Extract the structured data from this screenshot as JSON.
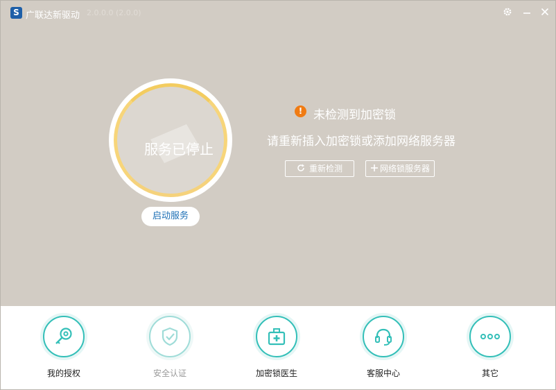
{
  "app": {
    "logo_glyph": "S",
    "title": "广联达新驱动",
    "version": "2.0.0.0 (2.0.0)"
  },
  "window_controls": {
    "settings_icon": "gear-icon",
    "minimize_icon": "minimize-icon",
    "close_icon": "close-icon"
  },
  "service": {
    "status": "服务已停止",
    "start_button": "启动服务"
  },
  "detection": {
    "warning_glyph": "!",
    "warning_text": "未检测到加密锁",
    "hint": "请重新插入加密锁或添加网络服务器",
    "redetect_button": "重新检测",
    "add_server_button": "网络锁服务器"
  },
  "tools": [
    {
      "label": "我的授权",
      "icon": "key-icon",
      "enabled": true
    },
    {
      "label": "安全认证",
      "icon": "shield-check-icon",
      "enabled": false
    },
    {
      "label": "加密锁医生",
      "icon": "medical-kit-icon",
      "enabled": true
    },
    {
      "label": "客服中心",
      "icon": "headset-icon",
      "enabled": true
    },
    {
      "label": "其它",
      "icon": "more-icon",
      "enabled": true
    }
  ],
  "colors": {
    "main_bg": "#d2ccc4",
    "accent_teal": "#33bfb8",
    "warning_orange": "#f07b13",
    "ring_yellow": "#f7d57a",
    "link_blue": "#1c6fb5"
  }
}
